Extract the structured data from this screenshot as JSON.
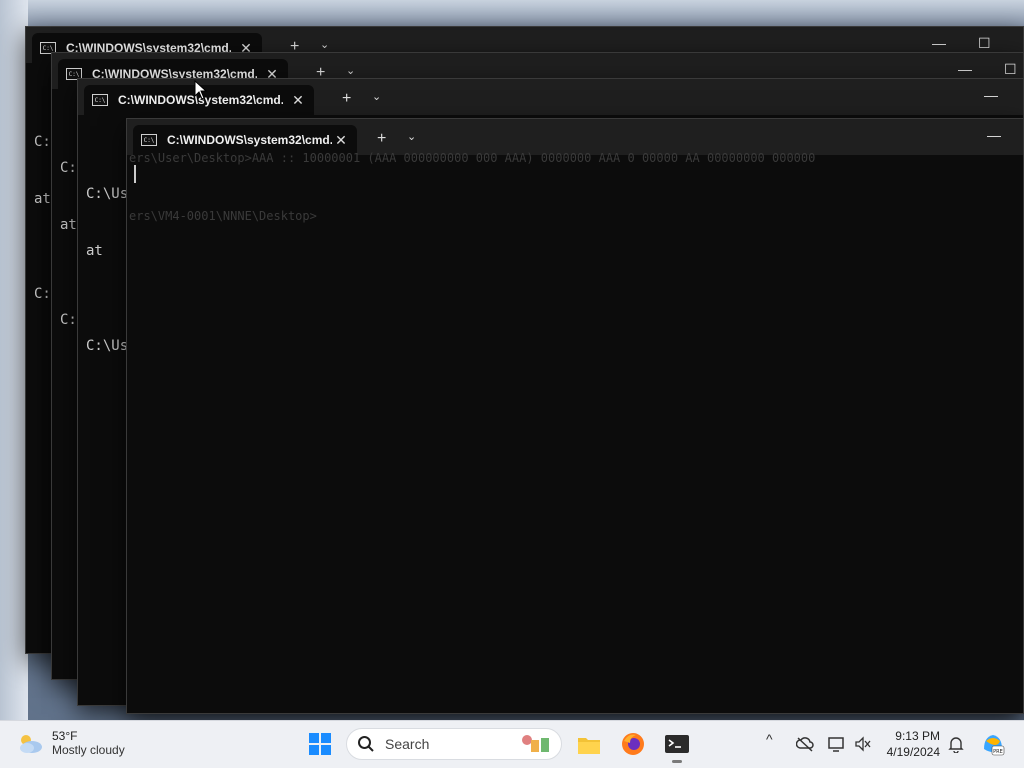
{
  "windows": [
    {
      "tab_title": "C:\\WINDOWS\\system32\\cmd.",
      "icon": "cmd-icon",
      "close_glyph": "✕",
      "new_tab_glyph": "+",
      "dropdown_glyph": "⌄",
      "lines": [
        "C:",
        "at",
        "",
        "C:"
      ]
    },
    {
      "tab_title": "C:\\WINDOWS\\system32\\cmd.",
      "icon": "cmd-icon",
      "close_glyph": "✕",
      "new_tab_glyph": "+",
      "dropdown_glyph": "⌄",
      "lines": [
        "C:",
        "at",
        "",
        "C:"
      ]
    },
    {
      "tab_title": "C:\\WINDOWS\\system32\\cmd.",
      "icon": "cmd-icon",
      "close_glyph": "✕",
      "new_tab_glyph": "+",
      "dropdown_glyph": "⌄",
      "lines": [
        "C:\\Us",
        "at",
        "",
        "C:\\Us"
      ]
    },
    {
      "tab_title": "C:\\WINDOWS\\system32\\cmd.",
      "icon": "cmd-icon",
      "close_glyph": "✕",
      "new_tab_glyph": "+",
      "dropdown_glyph": "⌄",
      "faint_line_1": "ers\\User\\Desktop>AAA :: 10000001 (AAA 000000000 000 AAA) 0000000 AAA 0 00000 AA 00000000 000000",
      "faint_line_2": "ers\\VM4-0001\\NNNE\\Desktop>"
    }
  ],
  "window_controls": {
    "minimize": "—",
    "maximize": "☐"
  },
  "taskbar": {
    "weather": {
      "temp": "53°F",
      "desc": "Mostly cloudy",
      "icon": "partly-cloudy-icon"
    },
    "search_label": "Search",
    "apps": [
      "file-explorer-icon",
      "firefox-icon",
      "terminal-icon"
    ],
    "tray": {
      "chevron": "^",
      "time": "9:13 PM",
      "date": "4/19/2024"
    }
  }
}
